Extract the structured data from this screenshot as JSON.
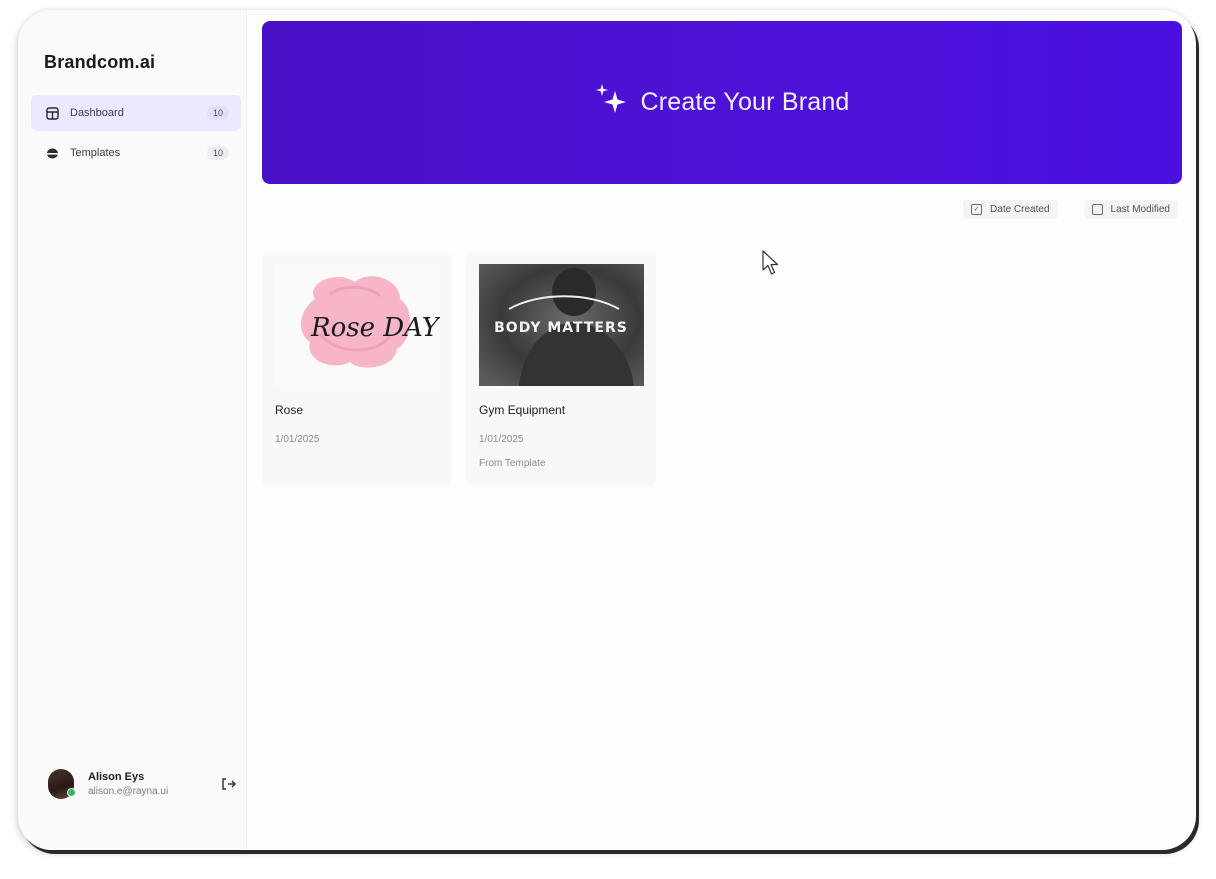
{
  "app": {
    "brand": "Brandcom.ai",
    "accent_color": "#4b12d6"
  },
  "sidebar": {
    "items": [
      {
        "label": "Dashboard",
        "count": "10",
        "icon": "dashboard-icon",
        "active": true
      },
      {
        "label": "Templates",
        "count": "10",
        "icon": "templates-icon",
        "active": false
      }
    ],
    "user": {
      "name": "Alison Eys",
      "email": "alison.e@rayna.ui",
      "status": "online",
      "logout_icon": "logout-icon"
    }
  },
  "hero": {
    "label": "Create Your Brand",
    "icon": "sparkle-icon"
  },
  "sort_options": [
    {
      "label": "Date Created",
      "checked": true
    },
    {
      "label": "Last Modified",
      "checked": false
    }
  ],
  "projects": [
    {
      "title": "Rose",
      "date": "1/01/2025",
      "thumb_text": "Rose DAY"
    },
    {
      "title": "Gym Equipment",
      "date": "1/01/2025",
      "source": "From Template",
      "thumb_text": "BODY MATTERS"
    }
  ]
}
